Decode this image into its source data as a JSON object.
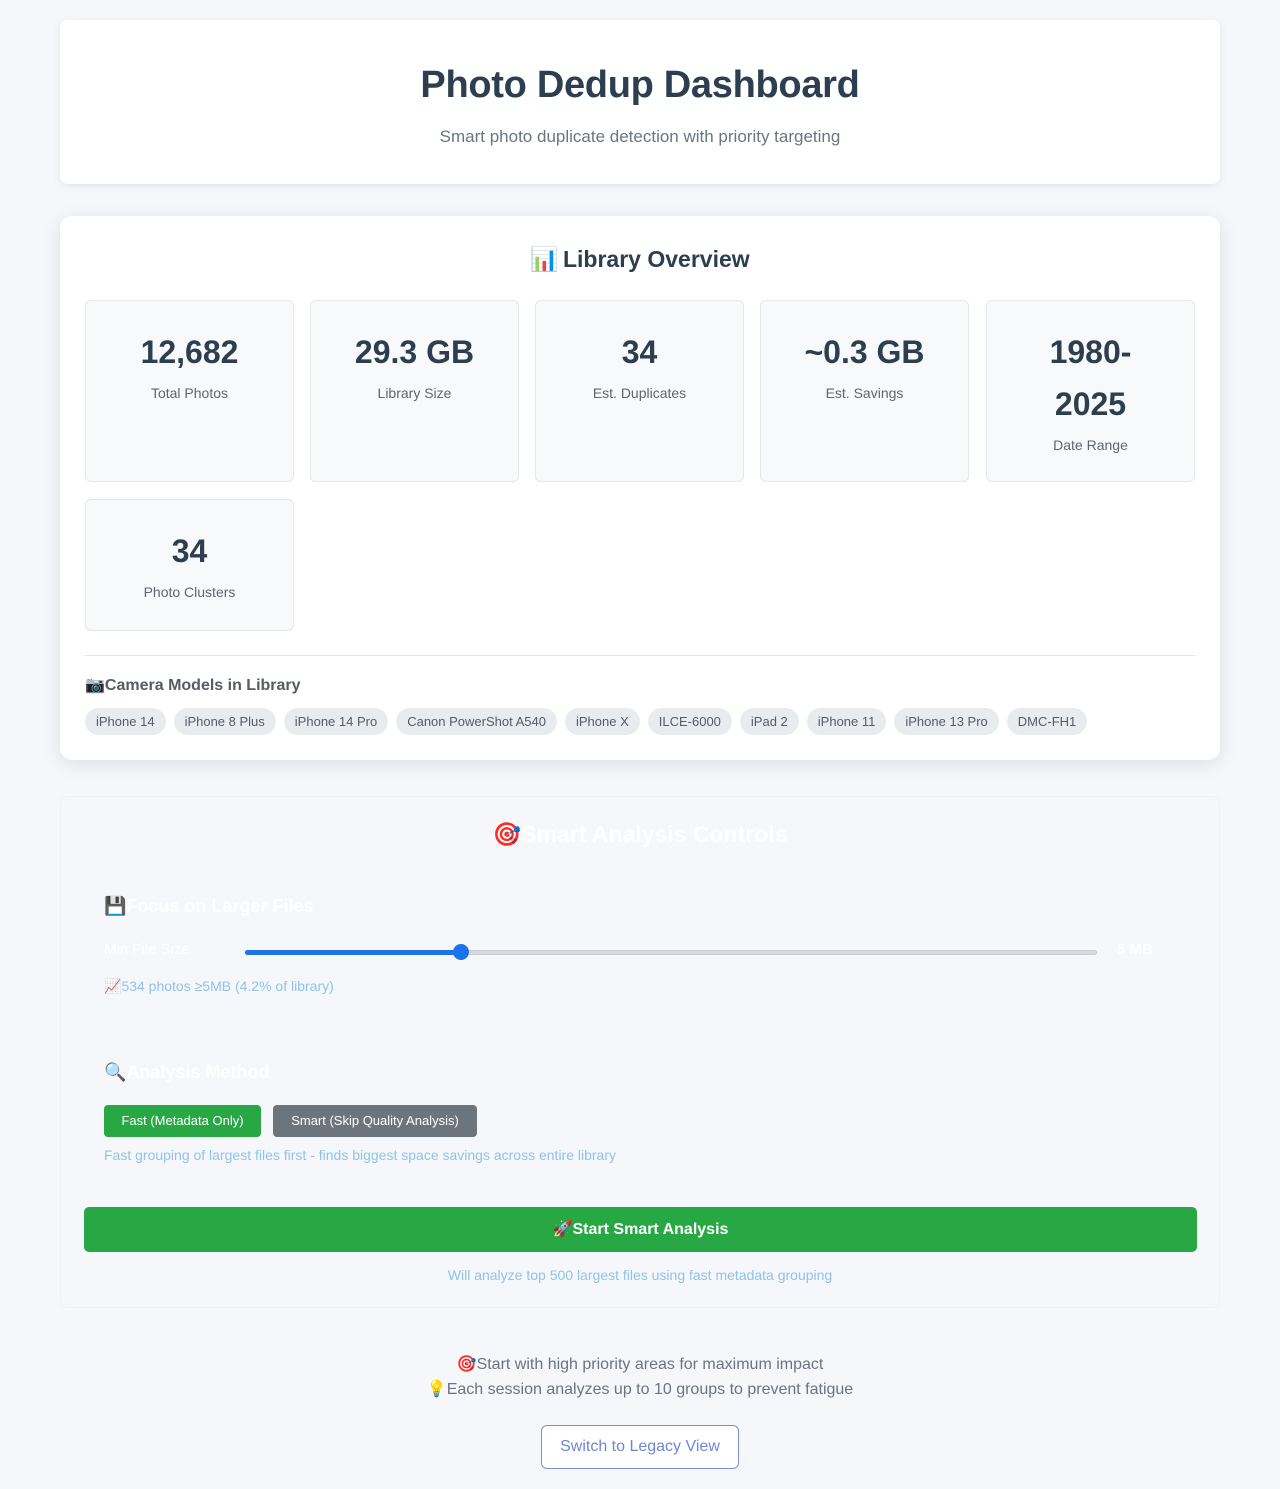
{
  "header": {
    "title": "Photo Dedup Dashboard",
    "subtitle": "Smart photo duplicate detection with priority targeting"
  },
  "overview": {
    "icon": "bar-chart-emoji",
    "icon_glyph": "📊",
    "title": "Library Overview",
    "stats": [
      {
        "value": "12,682",
        "label": "Total Photos"
      },
      {
        "value": "29.3 GB",
        "label": "Library Size"
      },
      {
        "value": "34",
        "label": "Est. Duplicates"
      },
      {
        "value": "~0.3 GB",
        "label": "Est. Savings"
      },
      {
        "value_line1": "1980-",
        "value_line2": "2025",
        "label": "Date Range"
      },
      {
        "value": "34",
        "label": "Photo Clusters"
      }
    ],
    "camera_icon_glyph": "📷",
    "camera_title": "Camera Models in Library",
    "camera_models": [
      "iPhone 14",
      "iPhone 8 Plus",
      "iPhone 14 Pro",
      "Canon PowerShot A540",
      "iPhone X",
      "ILCE-6000",
      "iPad 2",
      "iPhone 11",
      "iPhone 13 Pro",
      "DMC-FH1"
    ]
  },
  "controls": {
    "icon_glyph": "🎯",
    "title": "Smart Analysis Controls",
    "larger_files": {
      "icon_glyph": "💾",
      "title": "Focus on Larger Files",
      "min_label": "Min File Size:",
      "slider_fraction": 0.254,
      "value_text": "5 MB",
      "stats_icon_glyph": "📈",
      "stats_text": "534 photos ≥5MB (4.2% of library)"
    },
    "method": {
      "icon_glyph": "🔍",
      "title": "Analysis Method",
      "fast_label": "Fast (Metadata Only)",
      "smart_label": "Smart (Skip Quality Analysis)",
      "description": "Fast grouping of largest files first - finds biggest space savings across entire library"
    },
    "start_icon_glyph": "🚀",
    "start_label": "Start Smart Analysis",
    "start_note": "Will analyze top 500 largest files using fast metadata grouping"
  },
  "footer": {
    "tip1_icon_glyph": "🎯",
    "tip1": "Start with high priority areas for maximum impact",
    "tip2_icon_glyph": "💡",
    "tip2": "Each session analyzes up to 10 groups to prevent fatigue",
    "legacy_label": "Switch to Legacy View"
  }
}
